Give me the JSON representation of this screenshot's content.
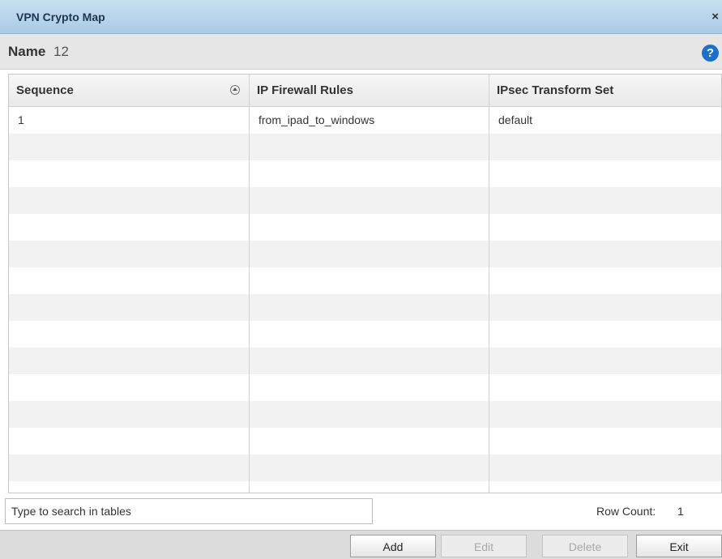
{
  "window": {
    "title": "VPN Crypto Map",
    "close_glyph": "×"
  },
  "name_bar": {
    "label": "Name",
    "value": "12",
    "help_glyph": "?"
  },
  "table": {
    "columns": [
      "Sequence",
      "IP Firewall Rules",
      "IPsec Transform Set"
    ],
    "rows": [
      [
        "1",
        "from_ipad_to_windows",
        "default"
      ]
    ],
    "empty_rows": 14,
    "sort_icon": "sort-ascending-icon"
  },
  "search": {
    "placeholder": "Type to search in tables",
    "value": ""
  },
  "row_count": {
    "label": "Row Count:",
    "value": "1"
  },
  "buttons": {
    "add": "Add",
    "edit": "Edit",
    "delete": "Delete",
    "exit": "Exit"
  },
  "colors": {
    "titlebar": "#b6d3ea",
    "help": "#1e6fc9",
    "alt_row": "#f2f2f2"
  }
}
